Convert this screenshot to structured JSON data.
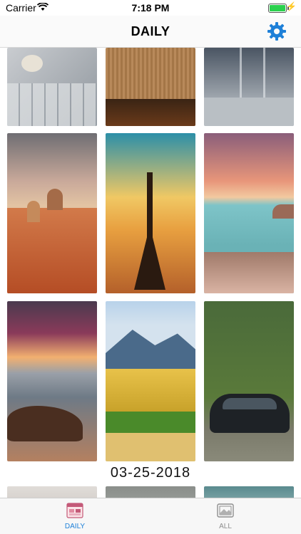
{
  "status_bar": {
    "carrier": "Carrier",
    "time": "7:18 PM",
    "battery_level": 1.0
  },
  "navbar": {
    "title": "DAILY",
    "settings_icon": "gear-icon"
  },
  "gallery": {
    "date_label": "03-25-2018"
  },
  "tabbar": {
    "tabs": [
      {
        "label": "DAILY",
        "icon": "calendar-gallery-icon",
        "selected": true
      },
      {
        "label": "ALL",
        "icon": "photo-library-icon",
        "selected": false
      }
    ]
  },
  "colors": {
    "accent": "#1e80d8",
    "inactive": "#8e8e8e"
  }
}
